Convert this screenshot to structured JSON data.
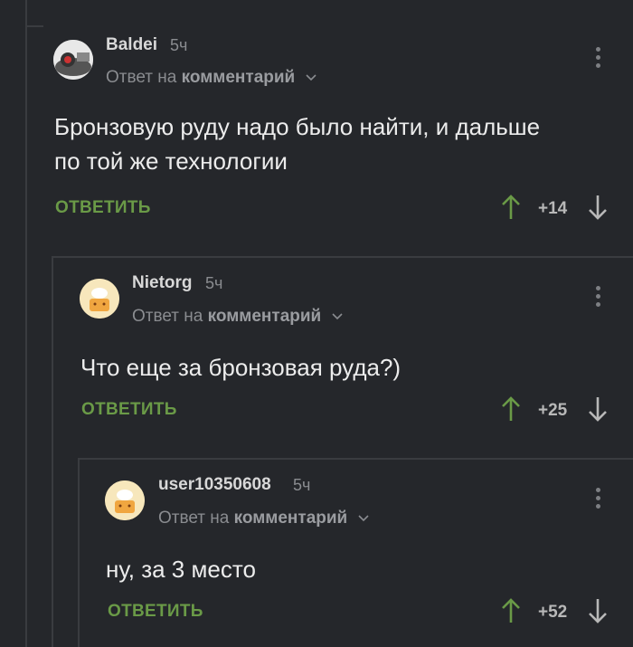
{
  "comments": [
    {
      "username": "Baldei",
      "time": "5ч",
      "reply_prefix": "Ответ на",
      "reply_target": "комментарий",
      "text_line1": "Бронзовую руду надо было найти, и дальше",
      "text_line2": "по той же технологии",
      "reply_label": "ОТВЕТИТЬ",
      "score": "+14"
    },
    {
      "username": "Nietorg",
      "time": "5ч",
      "reply_prefix": "Ответ на",
      "reply_target": "комментарий",
      "text_line1": "Что еще за бронзовая руда?)",
      "reply_label": "ОТВЕТИТЬ",
      "score": "+25"
    },
    {
      "username": "user10350608",
      "time": "5ч",
      "reply_prefix": "Ответ на",
      "reply_target": "комментарий",
      "text_line1": "ну, за 3 место",
      "reply_label": "ОТВЕТИТЬ",
      "score": "+52"
    }
  ],
  "colors": {
    "background": "#25272b",
    "accent_green": "#6a9a47",
    "thread_line": "#3a3c40"
  }
}
